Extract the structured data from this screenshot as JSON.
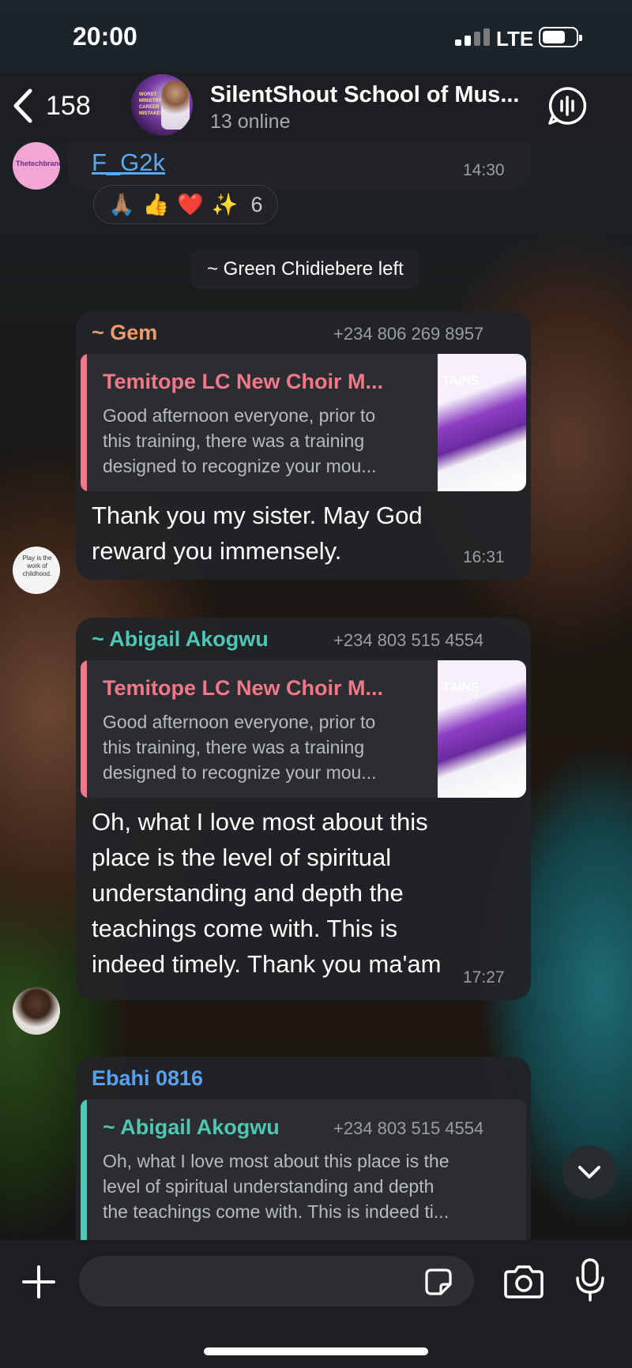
{
  "status_bar": {
    "time": "20:00",
    "network": "LTE"
  },
  "header": {
    "back_count": "158",
    "title": "SilentShout School of Mus...",
    "subtitle": "13 online",
    "avatar_text": "WORST MINISTRY CAREER MISTAKES"
  },
  "messages": {
    "msg1": {
      "link_text": "F_G2k",
      "time": "14:30",
      "avatar_text": "Thetechbrand",
      "reactions": {
        "emojis": [
          "🙏🏽",
          "👍",
          "❤️",
          "✨"
        ],
        "count": "6"
      }
    },
    "service": {
      "text": "~ Green Chidiebere left"
    },
    "msg2": {
      "sender": "~ Gem",
      "phone": "+234 806 269 8957",
      "reply": {
        "title": "Temitope LC New Choir M...",
        "lines": [
          "Good afternoon everyone, prior to",
          "this training, there was a training",
          "designed to recognize your mou..."
        ],
        "thumb_word": "TAINS"
      },
      "text_lines": [
        "Thank you my sister. May God",
        "reward you immensely."
      ],
      "time": "16:31",
      "avatar_text": "Play is the work of childhood."
    },
    "msg3": {
      "sender": "~ Abigail Akogwu",
      "phone": "+234 803 515 4554",
      "reply": {
        "title": "Temitope LC New Choir M...",
        "lines": [
          "Good afternoon everyone, prior to",
          "this training, there was a training",
          "designed to recognize your mou..."
        ],
        "thumb_word": "TAINS"
      },
      "text_lines": [
        "Oh, what I love most about this",
        "place is the level of spiritual",
        "understanding and depth the",
        "teachings come with. This is",
        "indeed timely. Thank you ma'am"
      ],
      "time": "17:27"
    },
    "msg4": {
      "sender": "Ebahi 0816",
      "reply": {
        "title": "~ Abigail Akogwu",
        "phone": "+234 803 515 4554",
        "lines": [
          "Oh, what I love most about this place is the",
          "level of spiritual understanding and depth",
          "the teachings come with. This is indeed ti..."
        ]
      }
    }
  },
  "composer": {
    "placeholder": ""
  },
  "colors": {
    "accent_link": "#5aa9f0",
    "gem_name": "#f09a6c",
    "abigail_name": "#4fc7b4",
    "ebahi_name": "#5aa0f0",
    "reply_title_pink": "#f0788a"
  }
}
